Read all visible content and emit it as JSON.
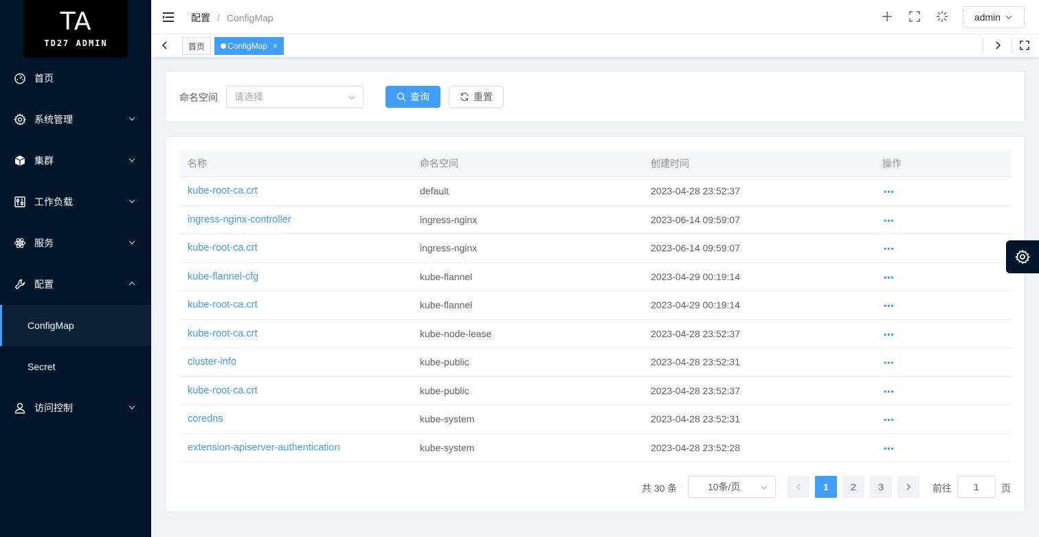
{
  "logo": {
    "title": "TA",
    "subtitle": "TD27 ADMIN"
  },
  "sidebar": {
    "items": [
      {
        "label": "首页",
        "icon": "dashboard-icon"
      },
      {
        "label": "系统管理",
        "icon": "gear-icon"
      },
      {
        "label": "集群",
        "icon": "box-icon"
      },
      {
        "label": "工作负载",
        "icon": "sliders-icon"
      },
      {
        "label": "服务",
        "icon": "atom-icon"
      },
      {
        "label": "配置",
        "icon": "wrench-icon"
      },
      {
        "label": "访问控制",
        "icon": "user-icon"
      }
    ],
    "sub": {
      "configmap": "ConfigMap",
      "secret": "Secret"
    }
  },
  "header": {
    "breadcrumb": [
      "配置",
      "ConfigMap"
    ],
    "separator": "/",
    "user": "admin"
  },
  "tabs": {
    "home": "首页",
    "active": "ConfigMap",
    "close": "×"
  },
  "search": {
    "label": "命名空间",
    "placeholder": "请选择",
    "query_label": "查询",
    "reset_label": "重置"
  },
  "table": {
    "columns": [
      "名称",
      "命名空间",
      "创建时间",
      "操作"
    ],
    "action_glyph": "•••",
    "rows": [
      {
        "name": "kube-root-ca.crt",
        "namespace": "default",
        "created": "2023-04-28 23:52:37"
      },
      {
        "name": "ingress-nginx-controller",
        "namespace": "ingress-nginx",
        "created": "2023-06-14 09:59:07"
      },
      {
        "name": "kube-root-ca.crt",
        "namespace": "ingress-nginx",
        "created": "2023-06-14 09:59:07"
      },
      {
        "name": "kube-flannel-cfg",
        "namespace": "kube-flannel",
        "created": "2023-04-29 00:19:14"
      },
      {
        "name": "kube-root-ca.crt",
        "namespace": "kube-flannel",
        "created": "2023-04-29 00:19:14"
      },
      {
        "name": "kube-root-ca.crt",
        "namespace": "kube-node-lease",
        "created": "2023-04-28 23:52:37"
      },
      {
        "name": "cluster-info",
        "namespace": "kube-public",
        "created": "2023-04-28 23:52:31"
      },
      {
        "name": "kube-root-ca.crt",
        "namespace": "kube-public",
        "created": "2023-04-28 23:52:37"
      },
      {
        "name": "coredns",
        "namespace": "kube-system",
        "created": "2023-04-28 23:52:31"
      },
      {
        "name": "extension-apiserver-authentication",
        "namespace": "kube-system",
        "created": "2023-04-28 23:52:28"
      }
    ]
  },
  "pagination": {
    "total": "共 30 条",
    "page_size": "10条/页",
    "pages": [
      "1",
      "2",
      "3"
    ],
    "current": "1",
    "goto_label": "前往",
    "goto_value": "1",
    "goto_suffix": "页"
  },
  "colors": {
    "primary": "#409eff",
    "sidebar": "#001529"
  }
}
